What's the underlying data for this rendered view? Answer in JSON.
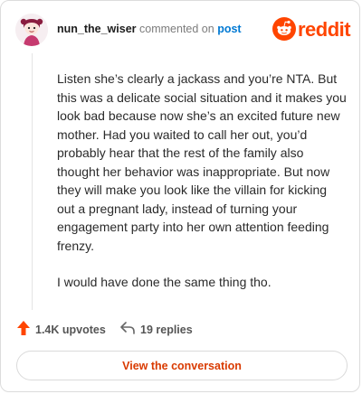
{
  "comment": {
    "username": "nun_the_wiser",
    "action_text": "commented on",
    "link_text": "post",
    "paragraphs": [
      "Listen she’s clearly a jackass and you’re NTA. But this was a delicate social situation and it makes you look bad because now she’s an excited future new mother. Had you waited to call her out, you’d probably hear that the rest of the family also thought her behavior was inappropriate. But now they will make you look like the villain for kicking out a pregnant lady, instead of turning your engagement party into her own attention feeding frenzy.",
      "I would have done the same thing tho."
    ]
  },
  "brand": {
    "name": "reddit",
    "color": "#ff4500"
  },
  "stats": {
    "upvotes": "1.4K upvotes",
    "replies": "19 replies"
  },
  "cta": {
    "label": "View the conversation"
  },
  "icons": [
    "avatar",
    "reddit-logo-icon",
    "upvote-arrow-icon",
    "reply-arrow-icon"
  ]
}
